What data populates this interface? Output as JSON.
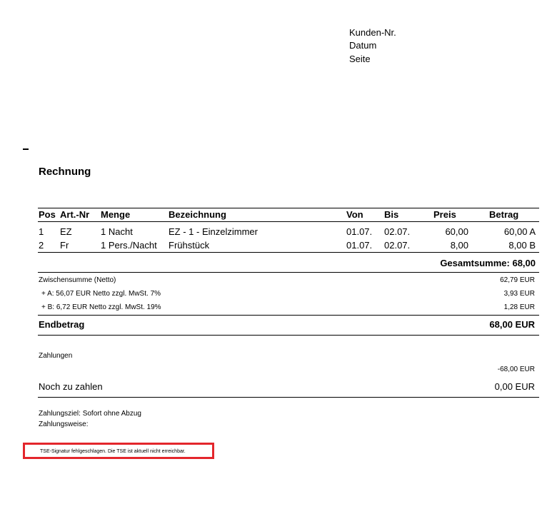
{
  "header": {
    "customer_no_label": "Kunden-Nr.",
    "date_label": "Datum",
    "page_label": "Seite"
  },
  "document": {
    "title": "Rechnung"
  },
  "table": {
    "headers": [
      "Pos",
      "Art.-Nr",
      "Menge",
      "Bezeichnung",
      "Von",
      "Bis",
      "Preis",
      "Betrag"
    ],
    "rows": [
      {
        "pos": "1",
        "art_nr": "EZ",
        "menge": "1 Nacht",
        "bezeichnung": "EZ - 1 - Einzelzimmer",
        "von": "01.07.",
        "bis": "02.07.",
        "preis": "60,00",
        "betrag": "60,00 A"
      },
      {
        "pos": "2",
        "art_nr": "Fr",
        "menge": "1 Pers./Nacht",
        "bezeichnung": "Frühstück",
        "von": "01.07.",
        "bis": "02.07.",
        "preis": "8,00",
        "betrag": "8,00 B"
      }
    ],
    "total_label": "Gesamtsumme: 68,00"
  },
  "summary": {
    "subtotal_label": "Zwischensumme (Netto)",
    "subtotal_value": "62,79 EUR",
    "tax_a_label": "+ A: 56,07 EUR Netto zzgl. MwSt. 7%",
    "tax_a_value": "3,93 EUR",
    "tax_b_label": "+ B: 6,72 EUR Netto zzgl. MwSt. 19%",
    "tax_b_value": "1,28 EUR",
    "final_label": "Endbetrag",
    "final_value": "68,00 EUR"
  },
  "payments": {
    "label": "Zahlungen",
    "value": "-68,00 EUR",
    "remaining_label": "Noch zu zahlen",
    "remaining_value": "0,00 EUR"
  },
  "terms": {
    "payment_target": "Zahlungsziel: Sofort ohne Abzug",
    "payment_method": "Zahlungsweise:"
  },
  "notice": {
    "tse_message": "TSE-Signatur fehlgeschlagen. Die TSE ist aktuell nicht erreichbar.",
    "border_color": "#e3262c"
  }
}
